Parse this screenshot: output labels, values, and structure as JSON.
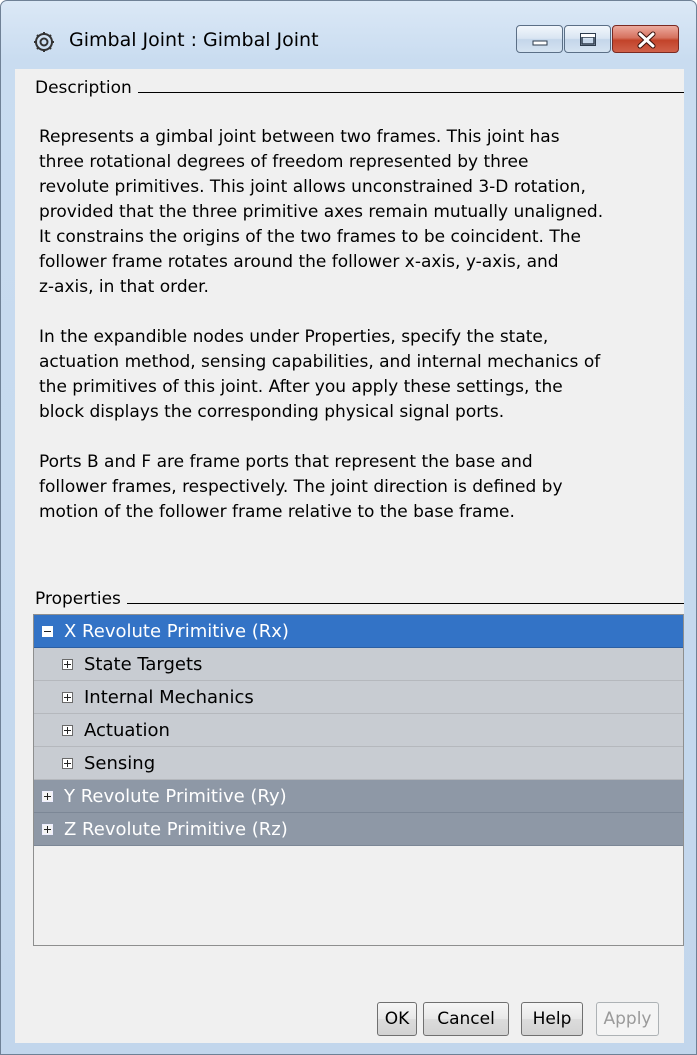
{
  "window": {
    "title": "Gimbal Joint : Gimbal Joint",
    "title_icon": "gear-block-icon",
    "controls": [
      "minimize-icon",
      "maximize-icon",
      "close-icon"
    ]
  },
  "description": {
    "heading": "Description",
    "paragraphs": [
      "Represents a gimbal joint between two frames. This joint has\nthree rotational degrees of freedom represented by three\nrevolute primitives. This joint allows unconstrained 3-D rotation,\nprovided that the three primitive axes remain mutually unaligned.\nIt constrains the origins of the two frames to be coincident. The\nfollower frame rotates around the follower x-axis, y-axis, and\nz-axis, in that order.",
      "In the expandible nodes under Properties, specify the state,\nactuation method, sensing capabilities, and internal mechanics of\nthe primitives of this joint. After you apply these settings, the\nblock displays the corresponding physical signal ports.",
      "Ports B and F are frame ports that represent the base and\nfollower frames, respectively. The joint direction is defined by\nmotion of the follower frame relative to the base frame."
    ]
  },
  "properties": {
    "heading": "Properties",
    "tree": [
      {
        "label": "X Revolute Primitive (Rx)",
        "expanded": true,
        "selected": true
      },
      {
        "label": "State Targets",
        "expanded": false
      },
      {
        "label": "Internal Mechanics",
        "expanded": false
      },
      {
        "label": "Actuation",
        "expanded": false
      },
      {
        "label": "Sensing",
        "expanded": false
      },
      {
        "label": "Y Revolute Primitive (Ry)",
        "expanded": false
      },
      {
        "label": "Z Revolute Primitive (Rz)",
        "expanded": false
      }
    ]
  },
  "buttons": {
    "ok": "OK",
    "cancel": "Cancel",
    "help": "Help",
    "apply": "Apply"
  },
  "colors": {
    "selected_row": "#3373c6",
    "child_row": "#c8ccd2",
    "parent_row": "#8e98a6",
    "close_button": "#c2432a"
  }
}
